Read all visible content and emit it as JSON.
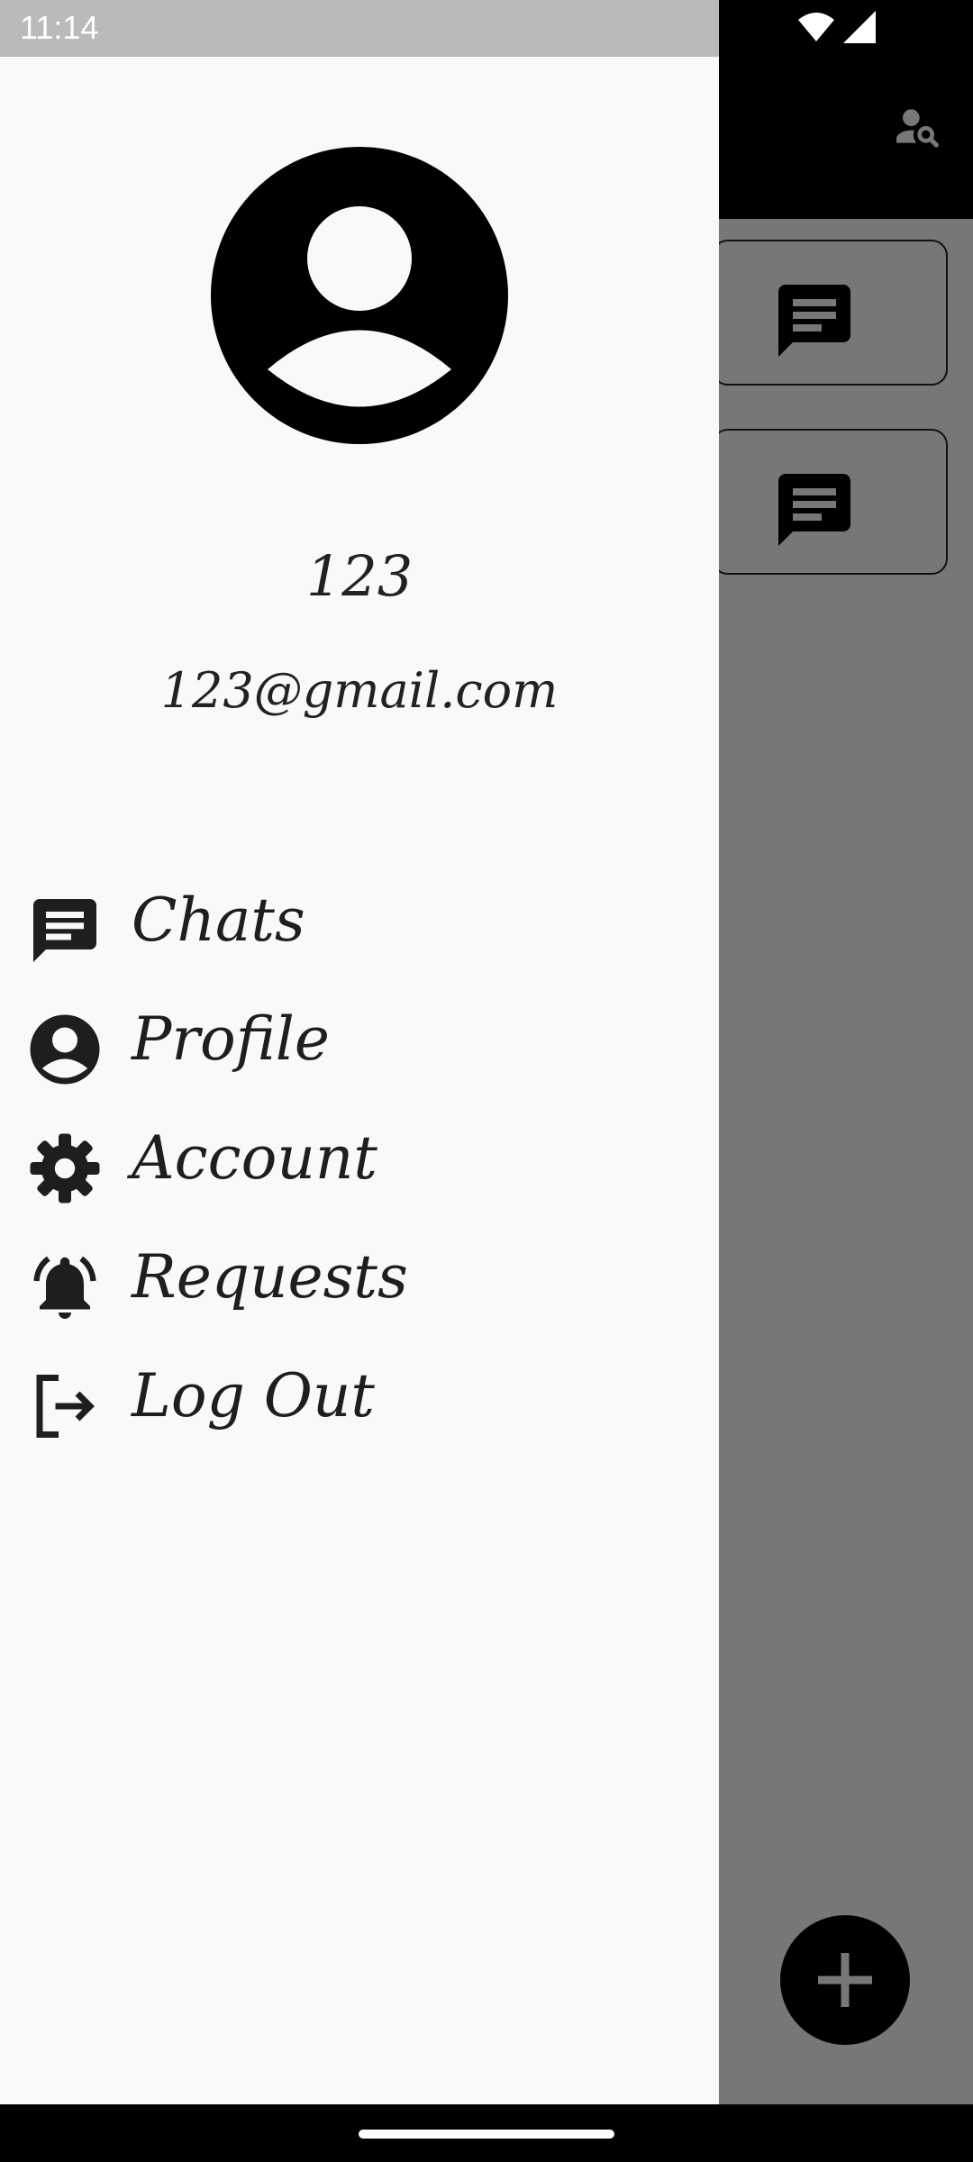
{
  "status_bar": {
    "time": "11:14"
  },
  "drawer": {
    "user": {
      "name": "123",
      "email": "123@gmail.com"
    },
    "menu": [
      {
        "label": "Chats",
        "icon": "chat-icon"
      },
      {
        "label": "Profile",
        "icon": "account-circle-icon"
      },
      {
        "label": "Account",
        "icon": "gear-icon"
      },
      {
        "label": "Requests",
        "icon": "bell-icon"
      },
      {
        "label": "Log Out",
        "icon": "logout-icon"
      }
    ]
  },
  "background": {
    "app_bar_icon": "person-search-icon",
    "cards": [
      {
        "icon": "chat-icon"
      },
      {
        "icon": "chat-icon"
      }
    ],
    "fab_icon": "plus-icon"
  }
}
